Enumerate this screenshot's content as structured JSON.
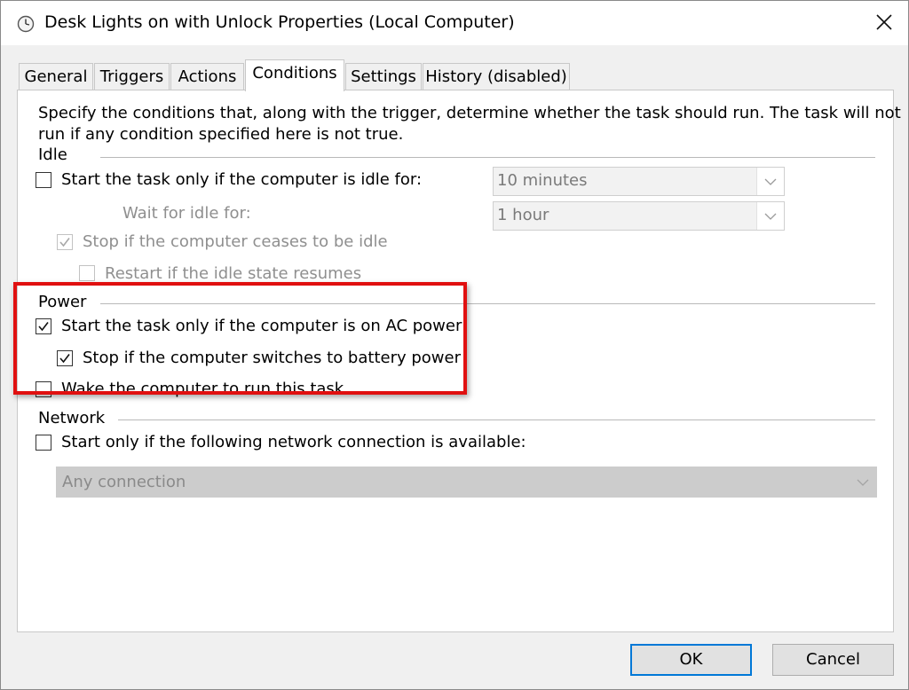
{
  "window": {
    "title": "Desk Lights on with Unlock Properties (Local Computer)"
  },
  "tabs": [
    {
      "label": "General"
    },
    {
      "label": "Triggers"
    },
    {
      "label": "Actions"
    },
    {
      "label": "Conditions",
      "active": true
    },
    {
      "label": "Settings"
    },
    {
      "label": "History (disabled)"
    }
  ],
  "description": {
    "line1": "Specify the conditions that, along with the trigger, determine whether the task should run.  The task will not",
    "line2": "run  if any condition specified here is not true."
  },
  "idle": {
    "heading": "Idle",
    "start_if_idle": {
      "label": "Start the task only if the computer is idle for:",
      "checked": false
    },
    "idle_for_value": "10 minutes",
    "wait_label": "Wait for idle for:",
    "wait_value": "1 hour",
    "stop_if_ceases": {
      "label": "Stop if the computer ceases to be idle",
      "checked": true,
      "disabled": true
    },
    "restart_if_resumes": {
      "label": "Restart if the idle state resumes",
      "checked": false,
      "disabled": true
    }
  },
  "power": {
    "heading": "Power",
    "ac_power": {
      "label": "Start the task only if the computer is on AC power",
      "checked": true
    },
    "battery": {
      "label": "Stop if the computer switches to battery power",
      "checked": true
    },
    "wake": {
      "label": "Wake the computer to run this task",
      "checked": false
    }
  },
  "network": {
    "heading": "Network",
    "start_if_network": {
      "label": "Start only if the following network connection is available:",
      "checked": false
    },
    "connection_value": "Any connection"
  },
  "buttons": {
    "ok": "OK",
    "cancel": "Cancel"
  },
  "colors": {
    "highlight": "#e01010",
    "default_button_border": "#0078d7"
  }
}
